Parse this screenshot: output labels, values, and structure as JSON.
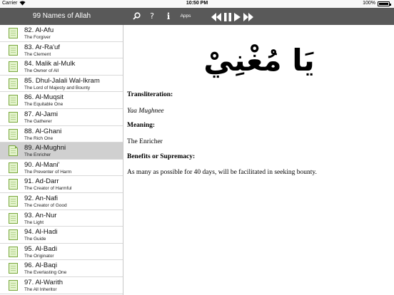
{
  "status_bar": {
    "carrier": "Carrier",
    "wifi_icon": "wifi-icon",
    "time": "10:50 PM",
    "battery_percent": "100%",
    "battery_icon": "battery-icon"
  },
  "nav_bar": {
    "title": "99 Names of Allah",
    "help_label": "?",
    "info_label": "i",
    "apps_label": "Apps",
    "icons": [
      "search-icon",
      "rewind-icon",
      "pause-icon",
      "play-icon",
      "fast-forward-icon"
    ]
  },
  "colors": {
    "nav_bar": "#595959",
    "selected_row": "#d0d0d0",
    "doc_icon_fill": "#e3f3cc",
    "doc_icon_border": "#7aa83e"
  },
  "names_list": [
    {
      "name": "82. Al-Afu",
      "meaning": "The Forgiver"
    },
    {
      "name": "83. Ar-Ra'uf",
      "meaning": "The Clement"
    },
    {
      "name": "84. Malik al-Mulk",
      "meaning": "The Owner of All"
    },
    {
      "name": "85. Dhul-Jalali Wal-Ikram",
      "meaning": "The Lord of Majesty and Bounty"
    },
    {
      "name": "86. Al-Muqsit",
      "meaning": "The Equitable One"
    },
    {
      "name": "87. Al-Jami",
      "meaning": "The Gatherer"
    },
    {
      "name": "88. Al-Ghani",
      "meaning": "The Rich One"
    },
    {
      "name": "89. Al-Mughni",
      "meaning": "The Enricher",
      "selected": true
    },
    {
      "name": "90. Al-Mani'",
      "meaning": "The Preventer of Harm"
    },
    {
      "name": "91. Ad-Darr",
      "meaning": "The Creator of Harmful"
    },
    {
      "name": "92. An-Nafi",
      "meaning": "The Creator of Good"
    },
    {
      "name": "93. An-Nur",
      "meaning": "The Light"
    },
    {
      "name": "94. Al-Hadi",
      "meaning": "The Guide"
    },
    {
      "name": "95. Al-Badi",
      "meaning": "The Originator"
    },
    {
      "name": "96. Al-Baqi",
      "meaning": "The Everlasting One"
    },
    {
      "name": "97. Al-Warith",
      "meaning": "The All Inheritor"
    }
  ],
  "detail": {
    "calligraphy_text": "يَا مُغْنِيْ",
    "transliteration_heading": "Transliteration:",
    "transliteration": "Yaa Mughnee",
    "meaning_heading": "Meaning:",
    "meaning": "The Enricher",
    "benefits_heading": "Benefits or Supremacy:",
    "benefits": "As many as possible for 40 days, will be facilitated in seeking bounty."
  }
}
